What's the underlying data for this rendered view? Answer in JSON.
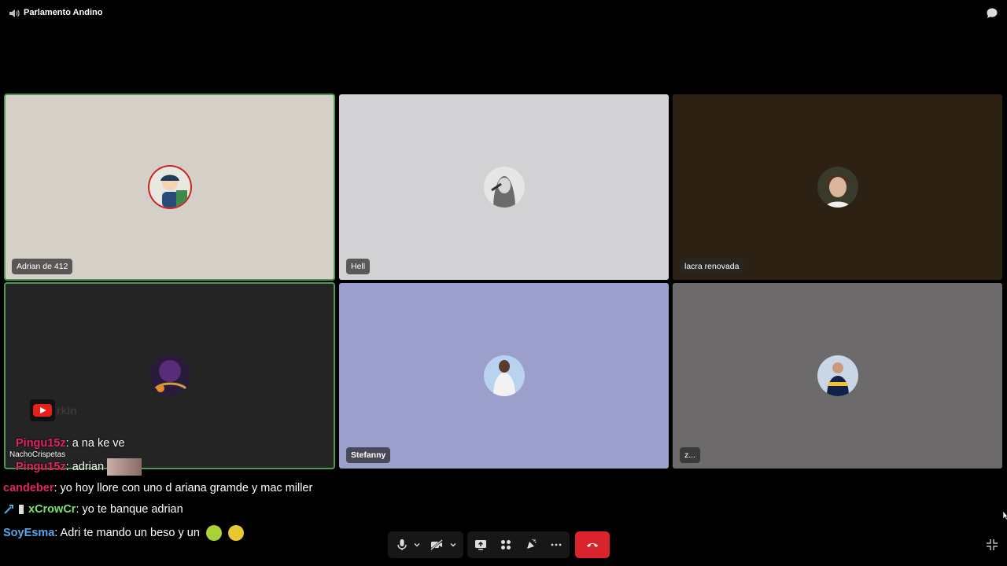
{
  "topbar": {
    "channel_icon": "speaker-icon",
    "channel_name": "Parlamento Andino",
    "chat_icon": "chat-bubble-icon"
  },
  "participants": [
    {
      "name": "Adrian de 412",
      "speaking": true,
      "tile_color": "#d4d0c8"
    },
    {
      "name": "Hell",
      "speaking": false,
      "tile_color": "#d2d2d4"
    },
    {
      "name": "lacra renovada",
      "speaking": false,
      "tile_color": "#2d2114"
    },
    {
      "name": "",
      "speaking": true,
      "tile_color": "#242424"
    },
    {
      "name": "Stefanny",
      "speaking": false,
      "tile_color": "#9a9fcb"
    },
    {
      "name": "z...",
      "speaking": false,
      "tile_color": "#6d6a6b"
    }
  ],
  "stream_overlay": {
    "logo_icon": "youtube-logo-icon",
    "ghost_text": "rkin",
    "sub_name": "NachoCrispetas",
    "messages": [
      {
        "user": "Pingu15z",
        "text": ": a na ke ve",
        "color": "#e0245e"
      },
      {
        "user": "Pingu15z",
        "text": ": adrian",
        "color": "#e0245e"
      },
      {
        "user": "candeber",
        "text": ": yo hoy llore con uno d ariana gramde y mac miller",
        "color": "#e0245e"
      },
      {
        "user": "xCrowCr",
        "text": ": yo te banque adrian",
        "color": "#7ce36b"
      },
      {
        "user": "SoyEsma",
        "text": ": Adri te mando un beso y un",
        "color": "#5aa8e8"
      }
    ]
  },
  "controls": {
    "mic_icon": "microphone-icon",
    "camera_icon": "camera-off-icon",
    "screenshare_icon": "screen-share-icon",
    "activities_icon": "activities-grid-icon",
    "soundboard_icon": "soundboard-icon",
    "more_icon": "more-dots-icon",
    "hangup_icon": "hang-up-icon",
    "exit_fullscreen_icon": "exit-fullscreen-icon",
    "hangup_color": "#d9232d"
  }
}
